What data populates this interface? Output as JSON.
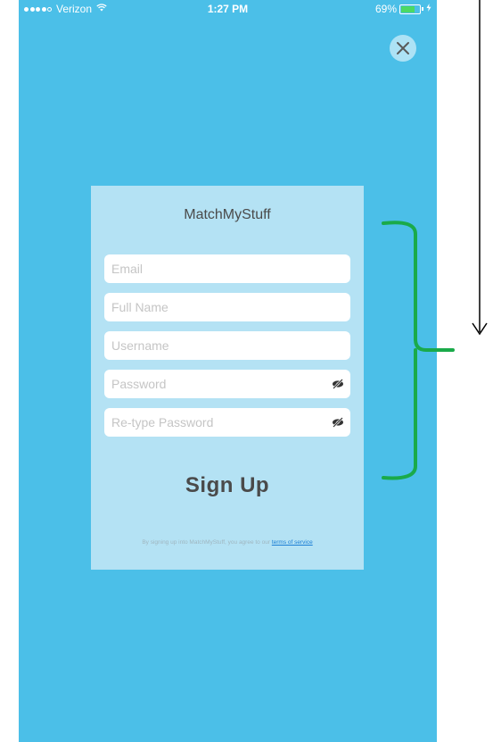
{
  "status_bar": {
    "carrier": "Verizon",
    "time": "1:27 PM",
    "battery_percent": "69%",
    "battery_level": 0.69,
    "wifi_icon": "wifi-icon",
    "charging_icon": "bolt-icon"
  },
  "close": {
    "icon": "close-icon"
  },
  "card": {
    "app_title": "MatchMyStuff",
    "fields": {
      "email_placeholder": "Email",
      "fullname_placeholder": "Full Name",
      "username_placeholder": "Username",
      "password_placeholder": "Password",
      "retype_placeholder": "Re-type Password"
    },
    "signup_label": "Sign Up",
    "terms_text": "By signing up into MatchMyStuff, you agree to our",
    "terms_link": "terms of service"
  },
  "colors": {
    "background": "#4bbfe8",
    "card": "#b4e2f4",
    "annotation_bracket": "#1aaa4a",
    "link": "#1a7ed4"
  }
}
